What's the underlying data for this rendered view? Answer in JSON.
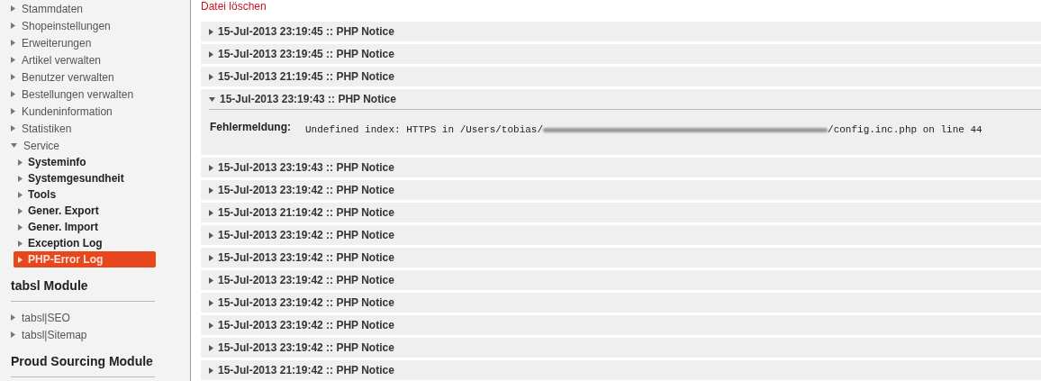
{
  "sidebar": {
    "menu": [
      {
        "label": "Stammdaten",
        "expanded": false
      },
      {
        "label": "Shopeinstellungen",
        "expanded": false
      },
      {
        "label": "Erweiterungen",
        "expanded": false
      },
      {
        "label": "Artikel verwalten",
        "expanded": false
      },
      {
        "label": "Benutzer verwalten",
        "expanded": false
      },
      {
        "label": "Bestellungen verwalten",
        "expanded": false
      },
      {
        "label": "Kundeninformation",
        "expanded": false
      },
      {
        "label": "Statistiken",
        "expanded": false
      },
      {
        "label": "Service",
        "expanded": true,
        "children": [
          {
            "label": "Systeminfo",
            "selected": false
          },
          {
            "label": "Systemgesundheit",
            "selected": false
          },
          {
            "label": "Tools",
            "selected": false
          },
          {
            "label": "Gener. Export",
            "selected": false
          },
          {
            "label": "Gener. Import",
            "selected": false
          },
          {
            "label": "Exception Log",
            "selected": false
          },
          {
            "label": "PHP-Error Log",
            "selected": true
          }
        ]
      }
    ],
    "modules": [
      {
        "heading": "tabsl Module",
        "items": [
          {
            "label": "tabsl|SEO",
            "selected": false
          },
          {
            "label": "tabsl|Sitemap",
            "selected": false
          }
        ]
      },
      {
        "heading": "Proud Sourcing Module"
      }
    ]
  },
  "main": {
    "delete_link": "Datei löschen",
    "entries": [
      {
        "header": "15-Jul-2013 23:19:45 :: PHP Notice",
        "expanded": false
      },
      {
        "header": "15-Jul-2013 23:19:45 :: PHP Notice",
        "expanded": false
      },
      {
        "header": "15-Jul-2013 21:19:45 :: PHP Notice",
        "expanded": false
      },
      {
        "header": "15-Jul-2013 23:19:43 :: PHP Notice",
        "expanded": true,
        "detail": {
          "label": "Fehlermeldung:",
          "message_start": "Undefined index: HTTPS in /Users/tobias/",
          "message_end": "/config.inc.php on line 44"
        }
      },
      {
        "header": "15-Jul-2013 23:19:43 :: PHP Notice",
        "expanded": false
      },
      {
        "header": "15-Jul-2013 23:19:42 :: PHP Notice",
        "expanded": false
      },
      {
        "header": "15-Jul-2013 21:19:42 :: PHP Notice",
        "expanded": false
      },
      {
        "header": "15-Jul-2013 23:19:42 :: PHP Notice",
        "expanded": false
      },
      {
        "header": "15-Jul-2013 23:19:42 :: PHP Notice",
        "expanded": false
      },
      {
        "header": "15-Jul-2013 23:19:42 :: PHP Notice",
        "expanded": false
      },
      {
        "header": "15-Jul-2013 23:19:42 :: PHP Notice",
        "expanded": false
      },
      {
        "header": "15-Jul-2013 23:19:42 :: PHP Notice",
        "expanded": false
      },
      {
        "header": "15-Jul-2013 23:19:42 :: PHP Notice",
        "expanded": false
      },
      {
        "header": "15-Jul-2013 21:19:42 :: PHP Notice",
        "expanded": false
      }
    ]
  }
}
